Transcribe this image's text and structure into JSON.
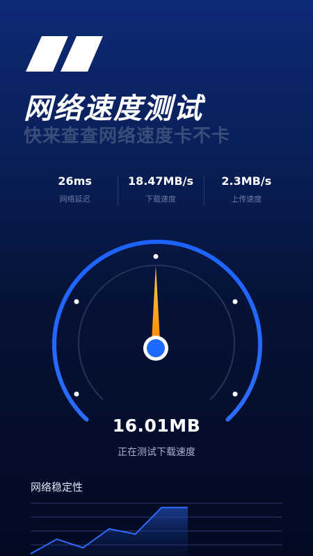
{
  "hero": {
    "title": "网络速度测试",
    "subtitle": "快来查查网络速度卡不卡",
    "quote_icon": "quote-mark-icon"
  },
  "stats": [
    {
      "value": "26ms",
      "label": "网络延迟"
    },
    {
      "value": "18.47MB/s",
      "label": "下载速度"
    },
    {
      "value": "2.3MB/s",
      "label": "上传速度"
    }
  ],
  "gauge": {
    "current_value": "16.01MB",
    "status": "正在测试下载速度",
    "needle_fraction": 0.5,
    "arc_color": "#1f6bff",
    "needle_color": "#ff9f1a"
  },
  "stability": {
    "title": "网络稳定性",
    "chart_data": {
      "type": "area",
      "values": [
        1,
        18,
        8,
        30,
        24,
        55,
        55
      ],
      "ylim": [
        0,
        60
      ],
      "grid": true,
      "color": "#2f6bff"
    }
  },
  "colors": {
    "background_top": "#0d2a76",
    "background_bottom": "#030a22",
    "accent": "#1f6bff"
  }
}
